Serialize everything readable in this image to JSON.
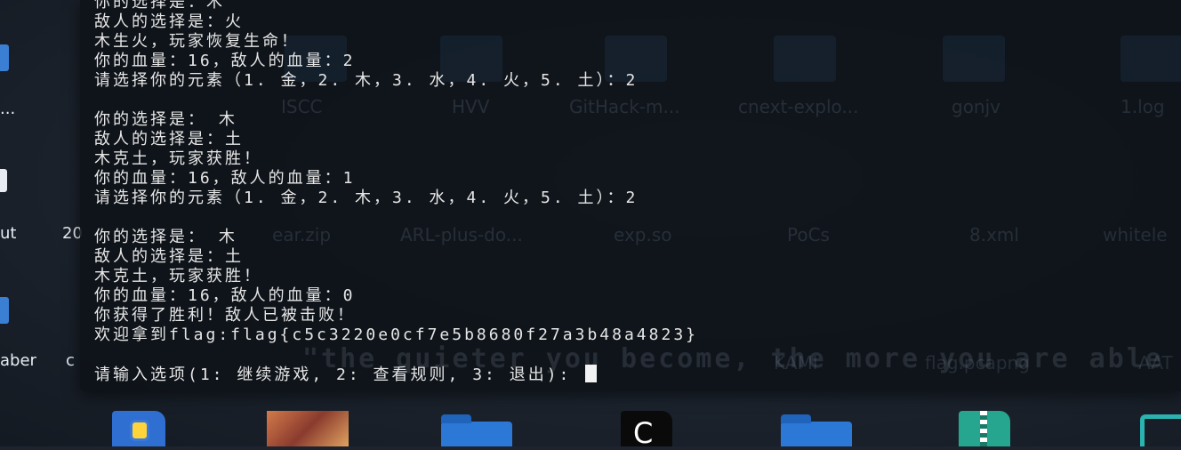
{
  "desktop": {
    "left_labels": [
      "...",
      "ut",
      "20",
      "aber",
      "c"
    ],
    "ghost_labels": [
      "ISCC",
      "HVV",
      "GitHack-m...",
      "cnext-explo...",
      "gonjv",
      "1.log",
      "ear.zip",
      "ARL-plus-do...",
      "exp.so",
      "PoCs",
      "8.xml",
      "whitele",
      "KAMI",
      "flag.pcapng",
      "AAT"
    ],
    "watermark_quote": "\"the quieter you become, the more you are able to"
  },
  "terminal": {
    "lines": [
      "你的选择是：木",
      "敌人的选择是：火",
      "木生火，玩家恢复生命！",
      "你的血量：16，敌人的血量：2",
      "请选择你的元素（1. 金，2. 木，3. 水，4. 火，5. 土）：2",
      "",
      "你的选择是： 木",
      "敌人的选择是：土",
      "木克土，玩家获胜！",
      "你的血量：16，敌人的血量：1",
      "请选择你的元素（1. 金，2. 木，3. 水，4. 火，5. 土）：2",
      "",
      "你的选择是： 木",
      "敌人的选择是：土",
      "木克土，玩家获胜！",
      "你的血量：16，敌人的血量：0",
      "你获得了胜利！敌人已被击败！",
      "欢迎拿到flag:flag{c5c3220e0cf7e5b8680f27a3b48a4823}",
      ""
    ],
    "prompt": "请输入选项(1: 继续游戏, 2: 查看规则, 3: 退出): "
  },
  "dock": {
    "items": [
      "python-file-icon",
      "photo-thumbnail",
      "folder-icon",
      "code-file-icon",
      "folder-icon",
      "zip-archive-icon",
      "monitor-icon"
    ]
  },
  "colors": {
    "terminal_bg": "#0e1218",
    "text": "#e6e6e6",
    "folder": "#2b78d6",
    "zip": "#26a68e"
  }
}
